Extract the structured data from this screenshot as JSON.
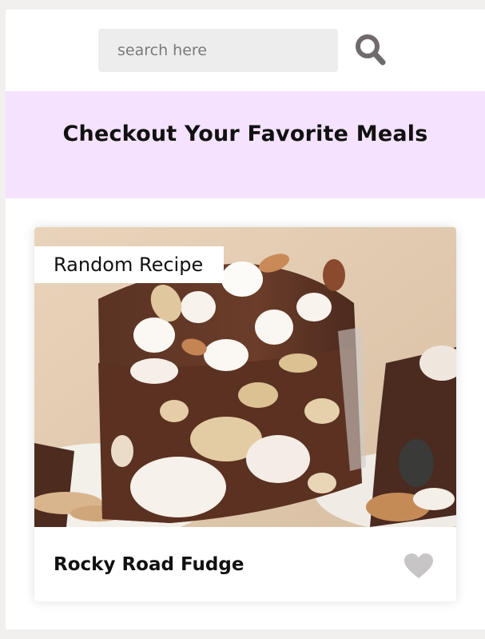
{
  "search": {
    "placeholder": "search here",
    "button_icon": "search-icon"
  },
  "banner": {
    "title": "Checkout Your Favorite Meals"
  },
  "card": {
    "tag": "Random Recipe",
    "title": "Rocky Road Fudge",
    "image": "rocky-road-fudge-photo",
    "favorite_icon": "heart-icon",
    "favorite_color": "#c8c5c6"
  },
  "colors": {
    "banner_bg": "#f5e2ff",
    "page_bg": "#f1f0ef",
    "search_icon": "#6e6a6e"
  }
}
